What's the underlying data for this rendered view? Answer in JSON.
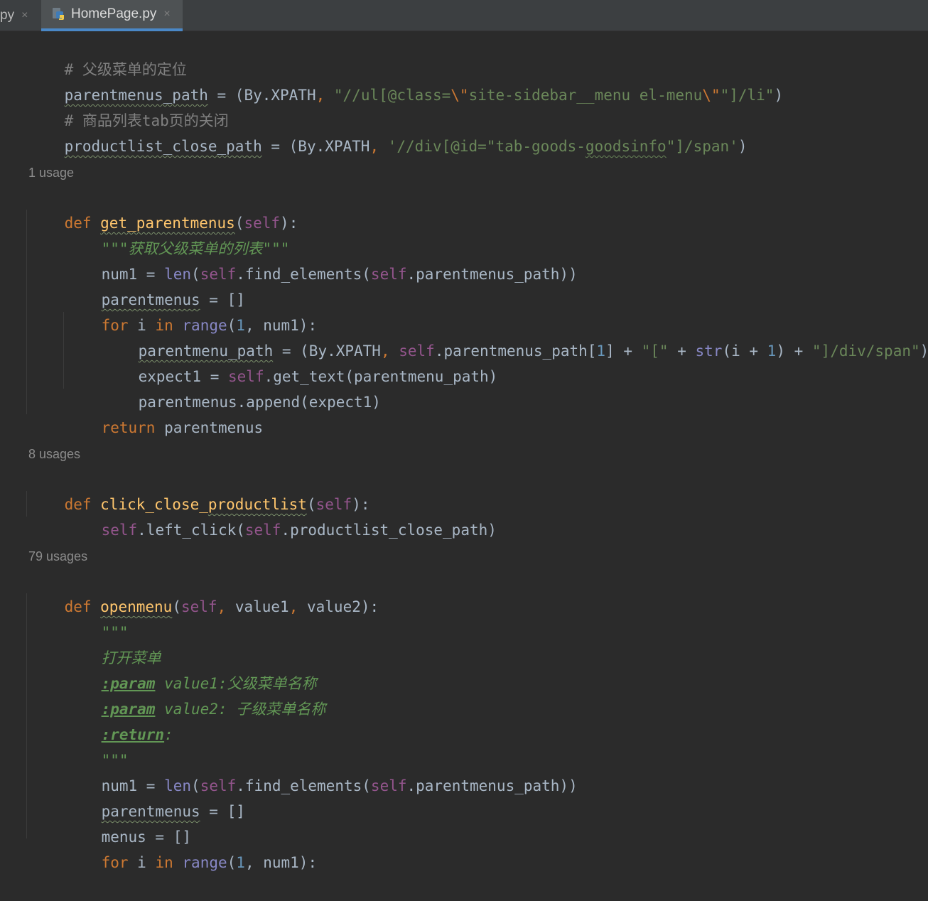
{
  "tabs": [
    {
      "label": "py",
      "close": "×"
    },
    {
      "label": "HomePage.py",
      "close": "×",
      "active": true
    }
  ],
  "colors": {
    "background": "#2b2b2b",
    "keyword": "#cc7832",
    "function": "#ffc66d",
    "string": "#6a8759",
    "comment": "#808080",
    "self": "#94558d",
    "number": "#6897bb",
    "active_tab_underline": "#4a88c7"
  },
  "icons": {
    "file_type": "python-file-icon"
  },
  "code": {
    "line1": "# 父级菜单的定位",
    "line2": {
      "var": "parentmenus_path",
      "op": " = (By.XPATH",
      "comma": ", ",
      "str1": "\"//ul[@class=",
      "esc1": "\\\"",
      "str2": "site-sidebar__menu el-menu",
      "esc2": "\\\"",
      "str3": "\"]/li\"",
      "close": ")"
    },
    "line3": "# 商品列表tab页的关闭",
    "line4": {
      "var": "productlist_close_path",
      "op": " = (By.XPATH",
      "comma": ", ",
      "str1": "'//div[@id=\"tab-goods-",
      "str_wavy": "goodsinfo",
      "str2": "\"]/span'",
      "close": ")"
    },
    "hint1": "1 usage",
    "def1": {
      "kw": "def ",
      "name": "get_parentmenus",
      "open": "(",
      "self": "self",
      "close": "):"
    },
    "l_doc": "\"\"\"获取父级菜单的列表\"\"\"",
    "l_num1a": {
      "a": "num1 = ",
      "len": "len",
      "b": "(",
      "self1": "self",
      "c": ".find_elements(",
      "self2": "self",
      "d": ".parentmenus_path))"
    },
    "l_pm": {
      "var": "parentmenus",
      "rest": " = []"
    },
    "l_for": {
      "kw1": "for",
      "a": " i ",
      "kw2": "in",
      "b": " ",
      "range": "range",
      "c": "(",
      "num": "1",
      "d": ", num1):"
    },
    "l_path": {
      "var": "parentmenu_path",
      "a": " = (By.XPATH",
      "comma": ", ",
      "self": "self",
      "b": ".parentmenus_path[",
      "idx": "1",
      "c": "] + ",
      "s1": "\"[\"",
      "d": " + ",
      "str": "str",
      "e": "(i + ",
      "one": "1",
      "f": ") + ",
      "s2": "\"]/div/span\"",
      "g": ")"
    },
    "l_expect": {
      "a": "expect1 = ",
      "self": "self",
      "b": ".get_text(parentmenu_path)"
    },
    "l_append": "parentmenus.append(expect1)",
    "l_return": {
      "kw": "return",
      "rest": " parentmenus"
    },
    "hint2": "8 usages",
    "def2": {
      "kw": "def ",
      "name_a": "click_close_",
      "name_b": "productlist",
      "open": "(",
      "self": "self",
      "close": "):"
    },
    "l_click": {
      "self1": "self",
      "a": ".left_click(",
      "self2": "self",
      "b": ".productlist_close_path)"
    },
    "hint3": "79 usages",
    "def3": {
      "kw": "def ",
      "name": "openmenu",
      "open": "(",
      "self": "self",
      "comma1": ", ",
      "p1": "value1",
      "comma2": ", ",
      "p2": "value2",
      "close": "):"
    },
    "doc_open": "\"\"\"",
    "doc_title": "打开菜单",
    "doc_param1": {
      "tag": ":param",
      "text": " value1:父级菜单名称"
    },
    "doc_param2": {
      "tag": ":param",
      "text": " value2: 子级菜单名称"
    },
    "doc_return": {
      "tag": ":return",
      "text": ":"
    },
    "doc_close": "\"\"\"",
    "l_num1b": {
      "a": "num1 = ",
      "len": "len",
      "b": "(",
      "self1": "self",
      "c": ".find_elements(",
      "self2": "self",
      "d": ".parentmenus_path))"
    },
    "l_pm2": {
      "var": "parentmenus",
      "rest": " = []"
    },
    "l_menus": "menus = []",
    "l_for2": {
      "kw1": "for",
      "a": " i ",
      "kw2": "in",
      "b": " ",
      "range": "range",
      "c": "(",
      "num": "1",
      "d": ", num1):"
    }
  }
}
